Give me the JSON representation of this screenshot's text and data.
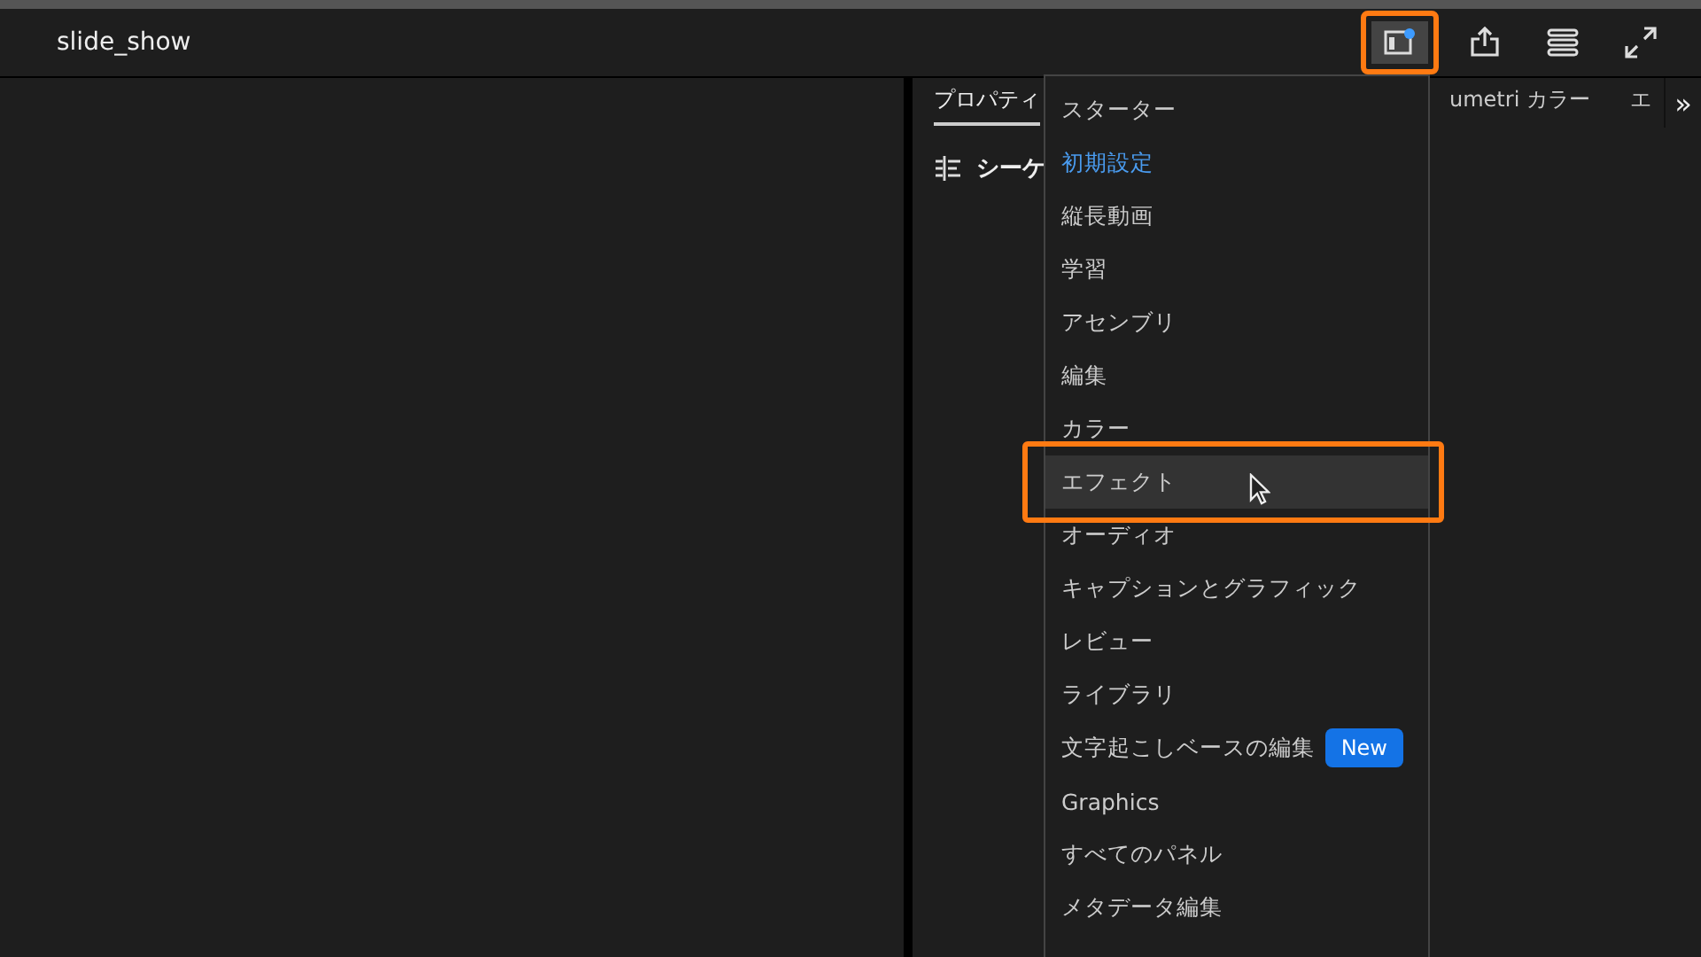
{
  "header": {
    "title": "slide_show",
    "workspace_button": {
      "highlighted": true,
      "badge": true
    }
  },
  "panel": {
    "tabs": [
      {
        "label": "プロパティ",
        "selected": true
      },
      {
        "label": "umetri カラー",
        "selected": false
      },
      {
        "label": "エ",
        "selected": false
      }
    ],
    "overflow": "»",
    "section": "シーケ"
  },
  "menu": {
    "items": [
      {
        "label": "スターター",
        "current": false,
        "hovered": false
      },
      {
        "label": "初期設定",
        "current": true,
        "hovered": false
      },
      {
        "label": "縦長動画",
        "current": false,
        "hovered": false
      },
      {
        "label": "学習",
        "current": false,
        "hovered": false
      },
      {
        "label": "アセンブリ",
        "current": false,
        "hovered": false
      },
      {
        "label": "編集",
        "current": false,
        "hovered": false
      },
      {
        "label": "カラー",
        "current": false,
        "hovered": false
      },
      {
        "label": "エフェクト",
        "current": false,
        "hovered": true
      },
      {
        "label": "オーディオ",
        "current": false,
        "hovered": false
      },
      {
        "label": "キャプションとグラフィック",
        "current": false,
        "hovered": false
      },
      {
        "label": "レビュー",
        "current": false,
        "hovered": false
      },
      {
        "label": "ライブラリ",
        "current": false,
        "hovered": false
      },
      {
        "label": "文字起こしベースの編集",
        "current": false,
        "hovered": false,
        "badge": "New"
      },
      {
        "label": "Graphics",
        "current": false,
        "hovered": false
      },
      {
        "label": "すべてのパネル",
        "current": false,
        "hovered": false
      },
      {
        "label": "メタデータ編集",
        "current": false,
        "hovered": false
      }
    ]
  }
}
